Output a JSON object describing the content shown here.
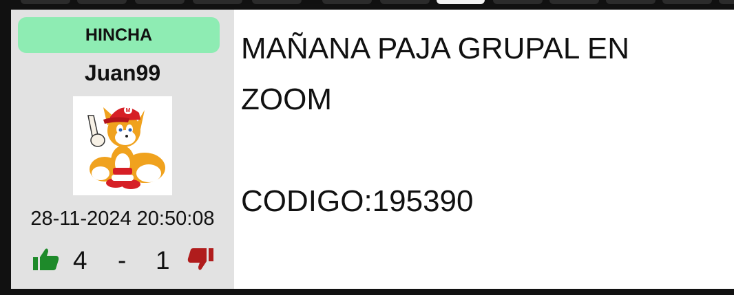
{
  "author": {
    "badge": "HINCHA",
    "username": "Juan99",
    "avatar_alt": "avatar"
  },
  "post": {
    "timestamp": "28-11-2024 20:50:08",
    "likes": "4",
    "separator": "-",
    "dislikes": "1",
    "body_line1": "MAÑANA PAJA GRUPAL EN",
    "body_line2": "ZOOM",
    "body_line3": "CODIGO:195390"
  },
  "colors": {
    "badge_bg": "#8eecb3",
    "sidebar_bg": "#e2e2e2",
    "like": "#1e8a2a",
    "dislike": "#b01c1c"
  },
  "icons": {
    "like": "thumbs-up-icon",
    "dislike": "thumbs-down-icon"
  }
}
